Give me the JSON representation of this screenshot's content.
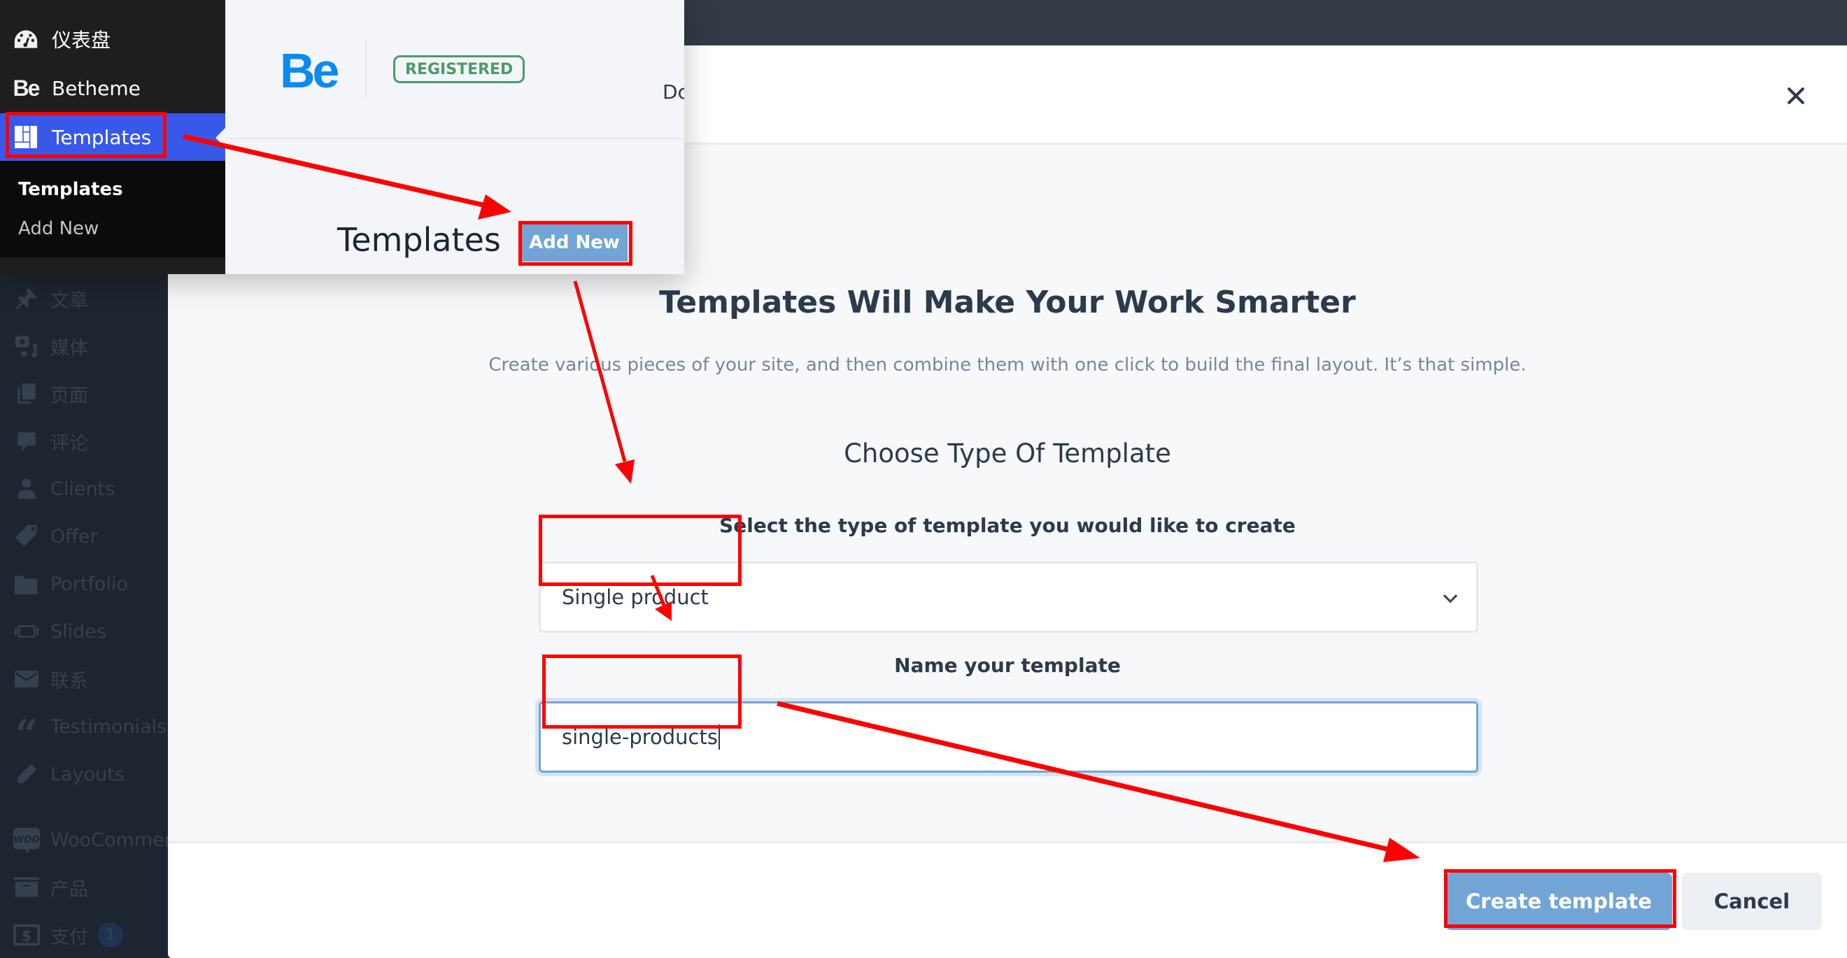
{
  "wp_sidebar": {
    "items": [
      {
        "label": "文章",
        "icon": "pin-icon"
      },
      {
        "label": "媒体",
        "icon": "media-icon"
      },
      {
        "label": "页面",
        "icon": "pages-icon"
      },
      {
        "label": "评论",
        "icon": "comments-icon"
      },
      {
        "label": "Clients",
        "icon": "person-icon"
      },
      {
        "label": "Offer",
        "icon": "tag-icon"
      },
      {
        "label": "Portfolio",
        "icon": "folder-icon"
      },
      {
        "label": "Slides",
        "icon": "slides-icon"
      },
      {
        "label": "联系",
        "icon": "mail-icon"
      },
      {
        "label": "Testimonials",
        "icon": "quote-icon"
      },
      {
        "label": "Layouts",
        "icon": "pencil-icon"
      },
      {
        "label": "WooCommerce",
        "icon": "woo-icon"
      },
      {
        "label": "产品",
        "icon": "archive-icon"
      },
      {
        "label": "支付",
        "icon": "dollar-icon",
        "badge": "1"
      }
    ]
  },
  "popup": {
    "menu": {
      "dashboard": "仪表盘",
      "betheme": "Betheme",
      "templates": "Templates",
      "submenu": [
        "Templates",
        "Add New"
      ]
    },
    "logo": "Be",
    "badge": "REGISTERED",
    "partial_text": "Dc",
    "page_title": "Templates",
    "add_new": "Add New"
  },
  "modal": {
    "close_icon": "×",
    "title": "Templates Will Make Your Work Smarter",
    "subtitle": "Create various pieces of your site, and then combine them with one click to build the final layout. It’s that simple.",
    "choose_heading": "Choose Type Of Template",
    "select_label": "Select the type of template you would like to create",
    "select_value": "Single product",
    "name_label": "Name your template",
    "name_value": "single-products",
    "create_button": "Create template",
    "cancel_button": "Cancel"
  },
  "colors": {
    "accent_blue": "#72a5d6",
    "wp_active": "#3858e9",
    "highlight_red": "#ff0000",
    "registered_green": "#4d9a6c"
  }
}
